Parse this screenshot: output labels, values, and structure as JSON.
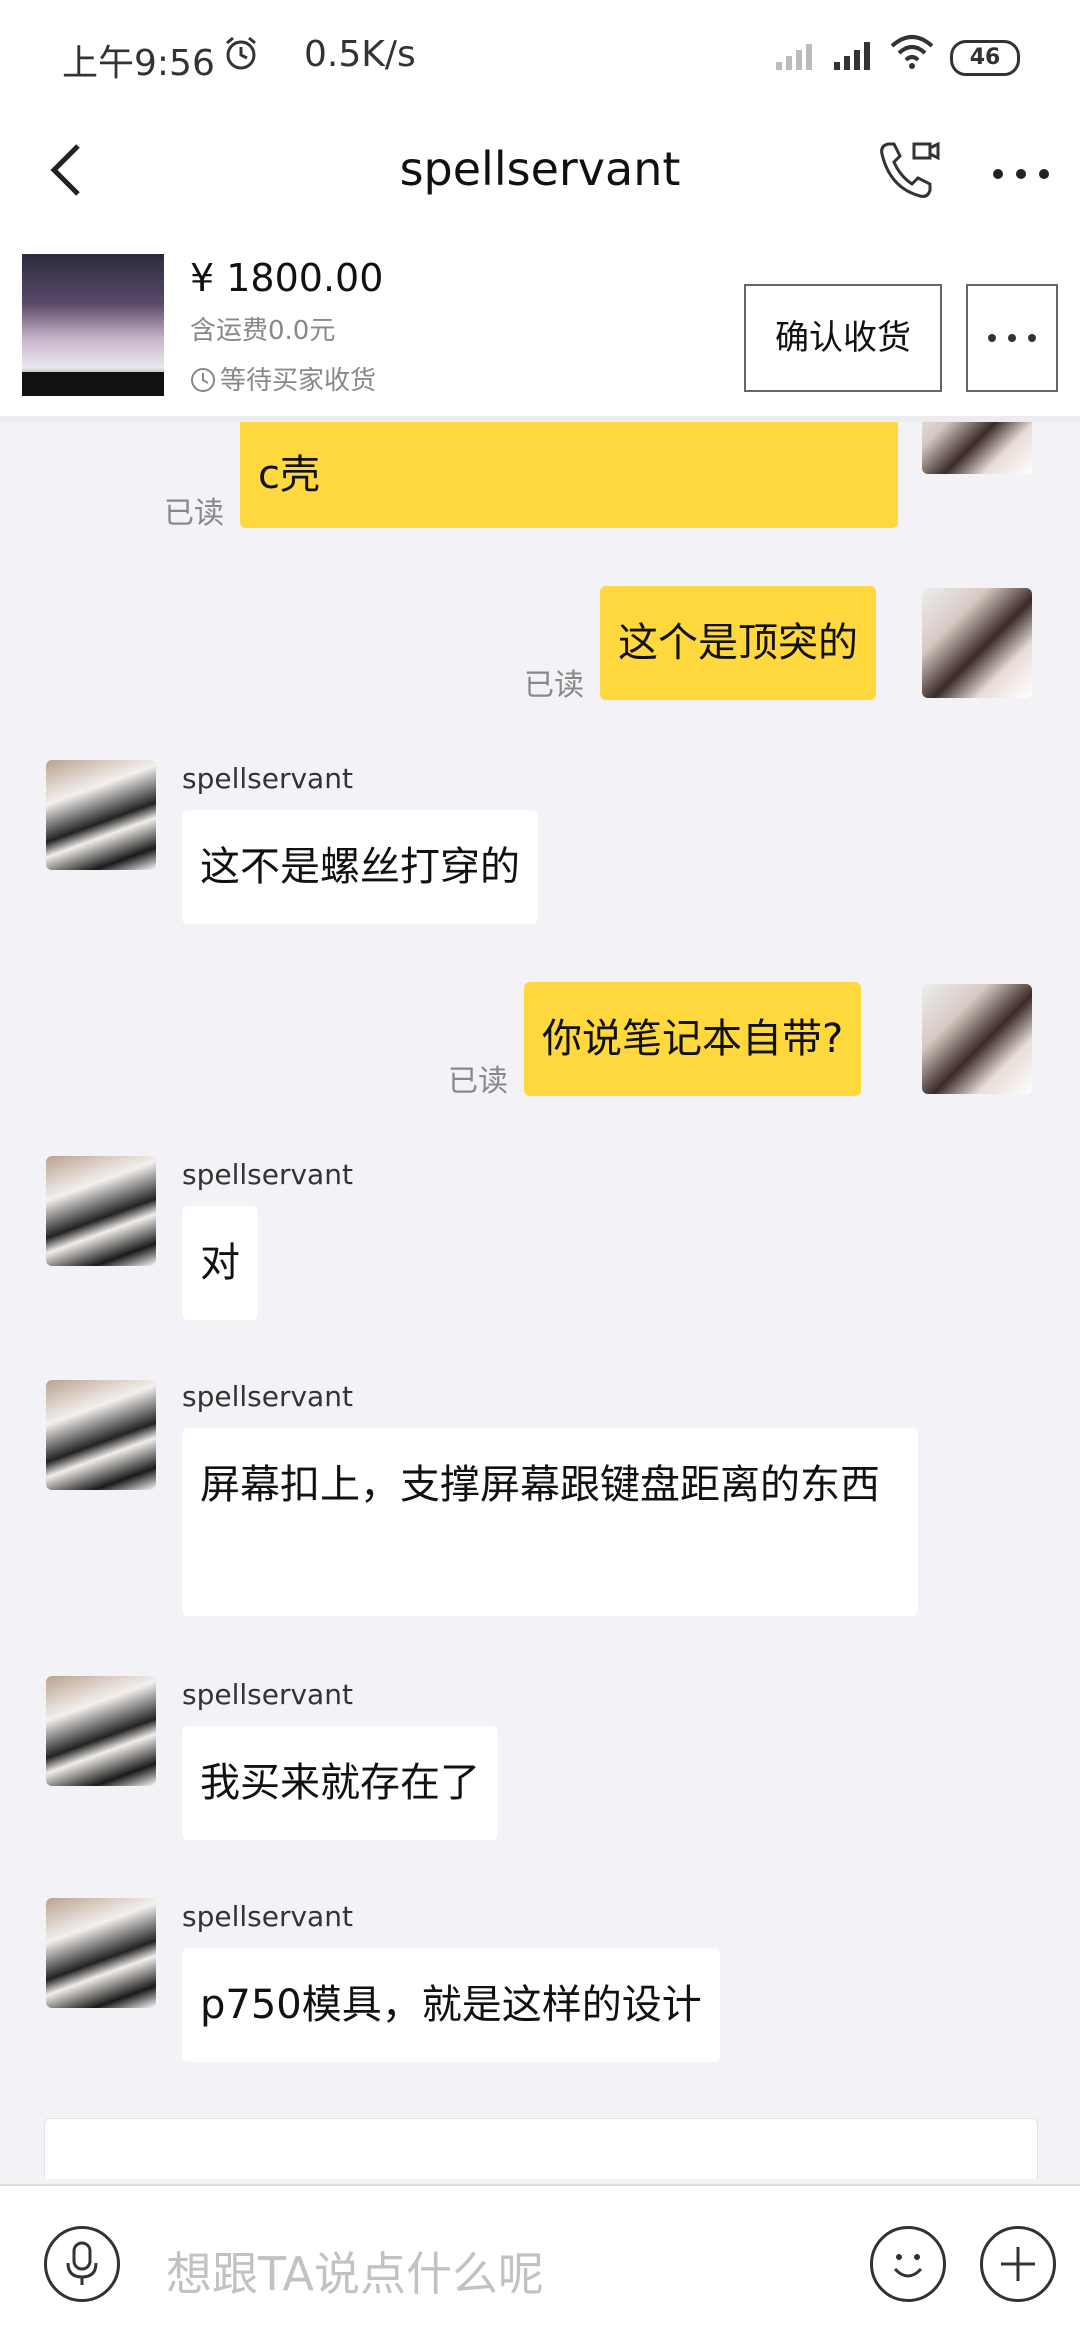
{
  "status_bar": {
    "time": "上午9:56",
    "network_speed": "0.5K/s",
    "battery": "46"
  },
  "header": {
    "title": "spellservant"
  },
  "product": {
    "price": "¥ 1800.00",
    "shipping": "含运费0.0元",
    "status": "等待买家收货",
    "confirm_label": "确认收货"
  },
  "messages": [
    {
      "from": "me",
      "text": "c壳",
      "read": "已读"
    },
    {
      "from": "me",
      "text": "这个是顶突的",
      "read": "已读"
    },
    {
      "from": "them",
      "sender": "spellservant",
      "text": "这不是螺丝打穿的"
    },
    {
      "from": "me",
      "text": "你说笔记本自带?",
      "read": "已读"
    },
    {
      "from": "them",
      "sender": "spellservant",
      "text": "对"
    },
    {
      "from": "them",
      "sender": "spellservant",
      "text": "屏幕扣上，支撑屏幕跟键盘距离的东西"
    },
    {
      "from": "them",
      "sender": "spellservant",
      "text": "我买来就存在了"
    },
    {
      "from": "them",
      "sender": "spellservant",
      "text": "p750模具，就是这样的设计"
    }
  ],
  "composer": {
    "placeholder": "想跟TA说点什么呢"
  },
  "colors": {
    "my_bubble": "#ffd83d",
    "their_bubble": "#ffffff",
    "background": "#f3f3f7"
  }
}
